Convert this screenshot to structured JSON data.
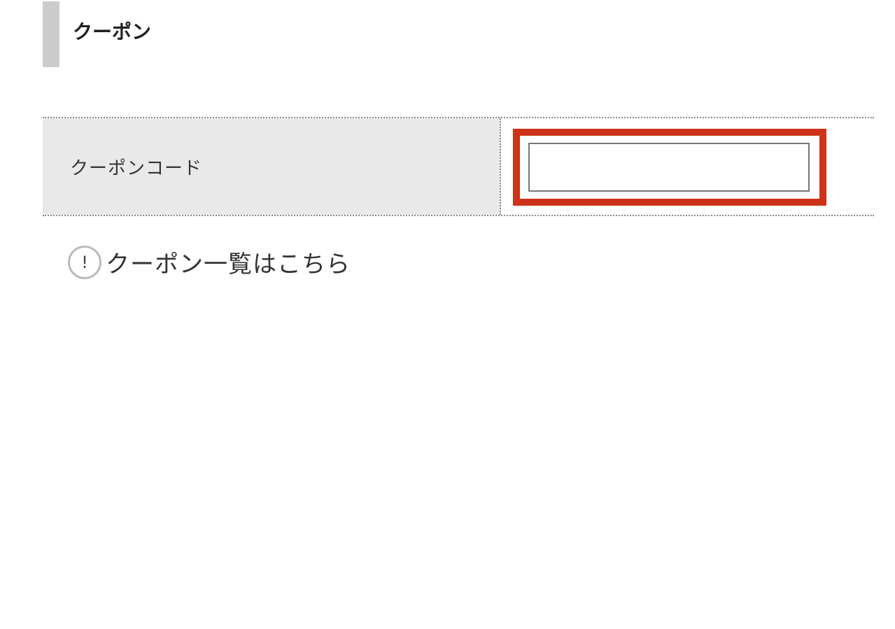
{
  "section": {
    "title": "クーポン"
  },
  "form": {
    "coupon_code_label": "クーポンコード",
    "coupon_code_value": "",
    "coupon_code_placeholder": ""
  },
  "links": {
    "coupon_list_icon": "!",
    "coupon_list_icon_name": "info-circle-icon",
    "coupon_list_text": "クーポン一覧はこちら"
  },
  "colors": {
    "highlight": "#cc3318",
    "label_background": "#e9e9e9",
    "heading_bar": "#cccccc"
  }
}
